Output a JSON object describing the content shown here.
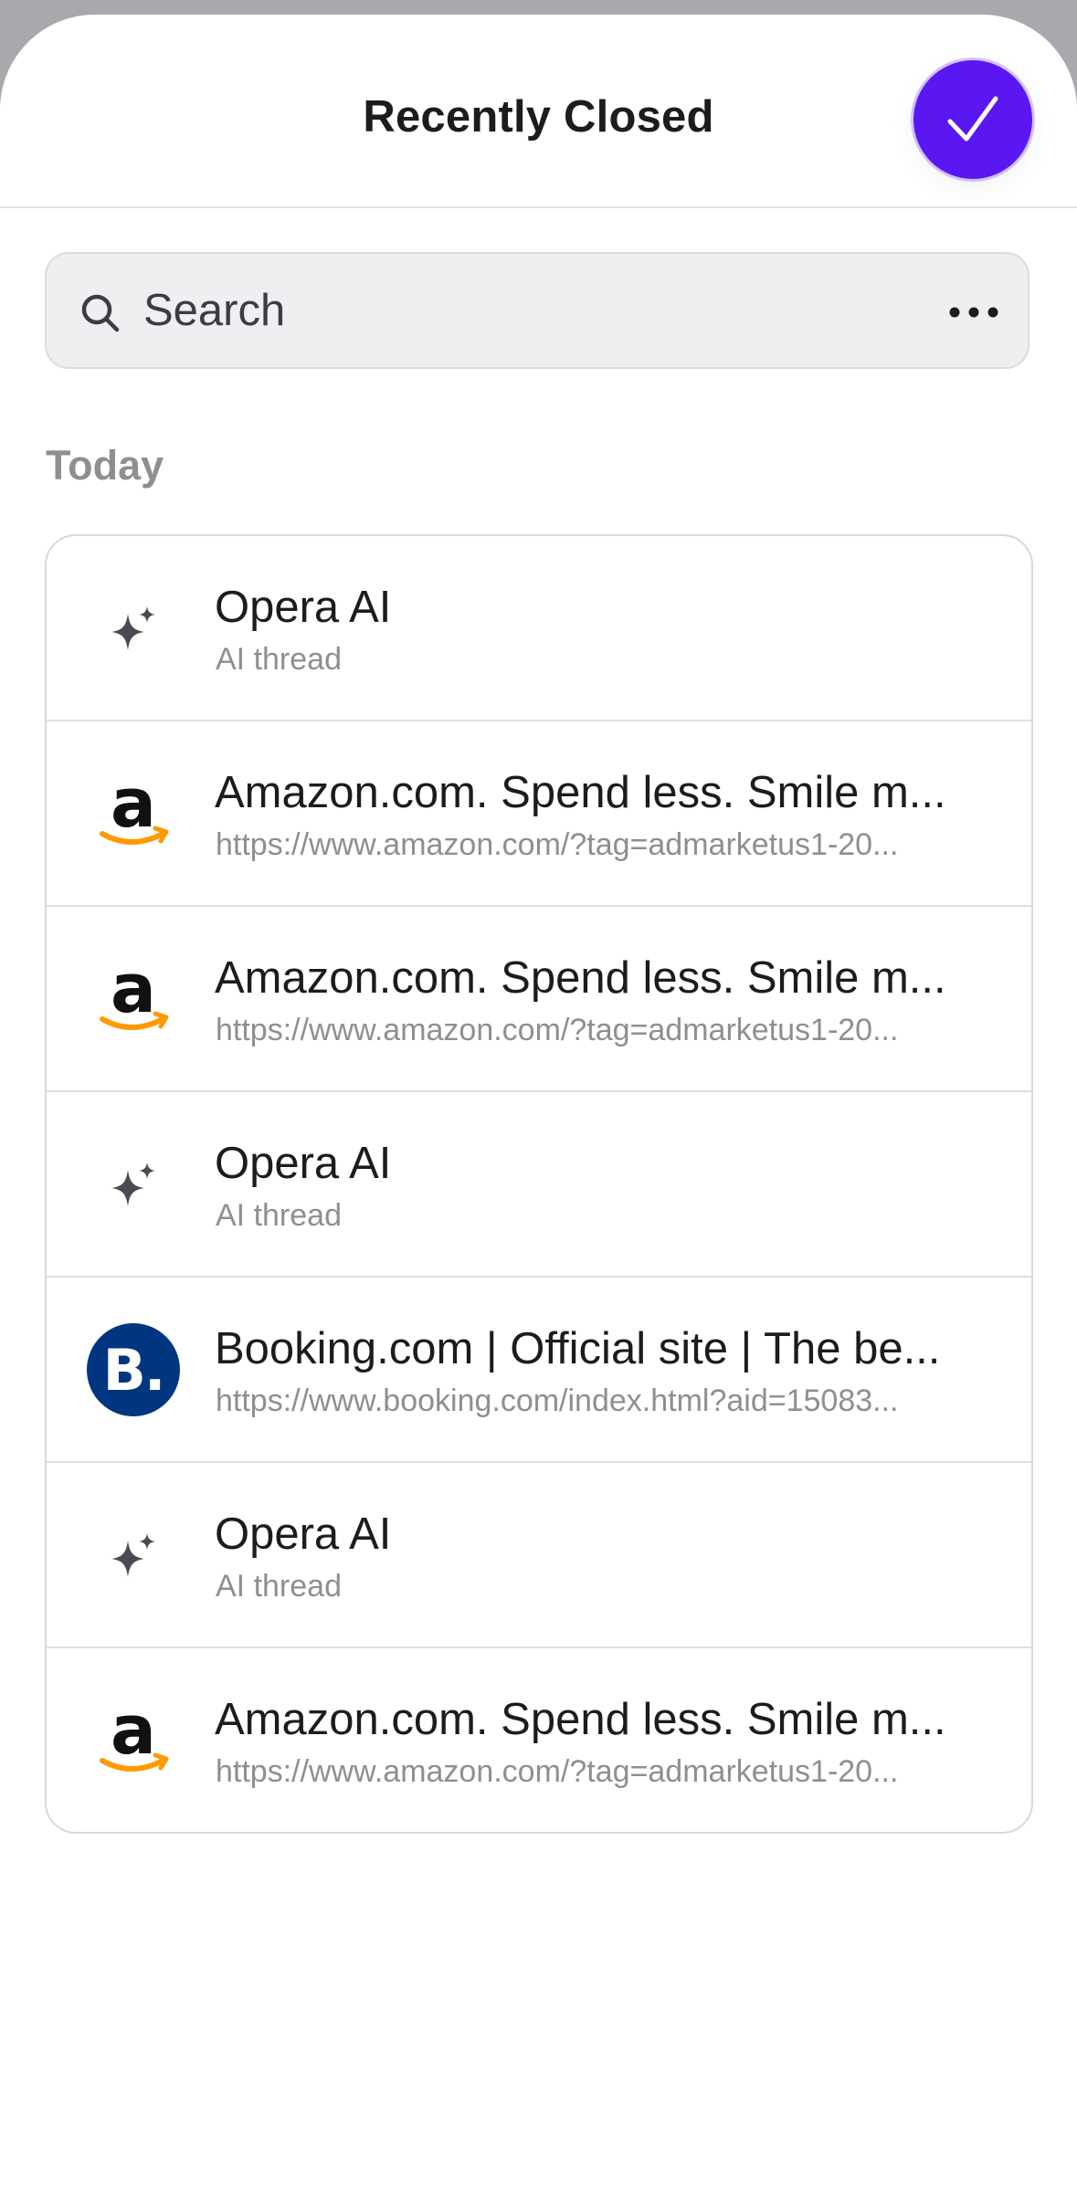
{
  "header": {
    "title": "Recently Closed"
  },
  "search": {
    "placeholder": "Search"
  },
  "section": {
    "label": "Today"
  },
  "colors": {
    "accent": "#5b17f2",
    "booking_brand": "#003580",
    "amazon_smile": "#ff9900"
  },
  "items": [
    {
      "icon": "sparkle-icon",
      "title": "Opera AI",
      "subtitle": "AI thread"
    },
    {
      "icon": "amazon-logo-icon",
      "title": "Amazon.com. Spend less. Smile m...",
      "subtitle": "https://www.amazon.com/?tag=admarketus1-20..."
    },
    {
      "icon": "amazon-logo-icon",
      "title": "Amazon.com. Spend less. Smile m...",
      "subtitle": "https://www.amazon.com/?tag=admarketus1-20..."
    },
    {
      "icon": "sparkle-icon",
      "title": "Opera AI",
      "subtitle": "AI thread"
    },
    {
      "icon": "booking-logo-icon",
      "logo_text": "B.",
      "title": "Booking.com | Official site | The be...",
      "subtitle": "https://www.booking.com/index.html?aid=15083..."
    },
    {
      "icon": "sparkle-icon",
      "title": "Opera AI",
      "subtitle": "AI thread"
    },
    {
      "icon": "amazon-logo-icon",
      "title": "Amazon.com. Spend less. Smile m...",
      "subtitle": "https://www.amazon.com/?tag=admarketus1-20..."
    }
  ]
}
